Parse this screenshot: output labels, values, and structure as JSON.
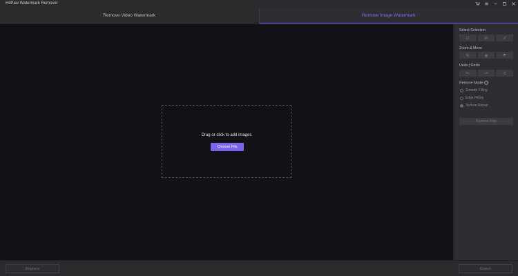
{
  "app": {
    "title": "HitPaw Watermark Remover"
  },
  "window_controls": [
    {
      "name": "cart-icon"
    },
    {
      "name": "menu-icon"
    },
    {
      "name": "minimize-icon"
    },
    {
      "name": "maximize-icon"
    },
    {
      "name": "close-icon"
    }
  ],
  "tabs": [
    {
      "label": "Remove Video Watermark",
      "active": false
    },
    {
      "label": "Remove Image Watermark",
      "active": true
    }
  ],
  "dropzone": {
    "prompt": "Drag or click to add images",
    "button_label": "Choose File"
  },
  "panel": {
    "select_selection": {
      "label": "Select Selection",
      "tools": [
        "rect-select-icon",
        "lasso-icon",
        "brush-icon"
      ]
    },
    "zoom_move": {
      "label": "Zoom & Move",
      "tools": [
        "zoom-in-icon",
        "hand-move-icon",
        "flag-icon"
      ]
    },
    "undo_redo": {
      "label": "Undo | Redo",
      "tools": [
        "undo-icon",
        "redo-icon",
        "reset-icon"
      ]
    },
    "remove_mode": {
      "label": "Remove Mode",
      "options": [
        {
          "label": "Smooth Filling",
          "checked": false
        },
        {
          "label": "Edge Filling",
          "checked": false
        },
        {
          "label": "Texture Repair",
          "checked": true
        }
      ]
    },
    "remove_now_label": "Remove Now"
  },
  "bottom": {
    "replace_label": "Replace",
    "export_label": "Export"
  },
  "colors": {
    "accent": "#7b63ea",
    "canvas": "#121115",
    "panel": "#2e2e32"
  }
}
